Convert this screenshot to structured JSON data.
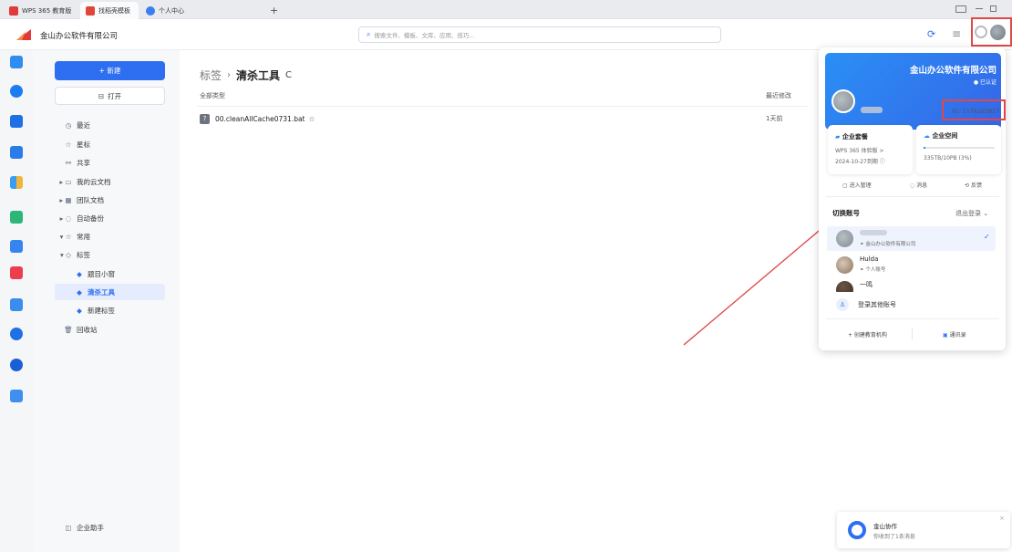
{
  "tabs": [
    {
      "label": "WPS 365 教育版"
    },
    {
      "label": "找稻壳模板"
    },
    {
      "label": "个人中心"
    }
  ],
  "tab_new": "+",
  "header": {
    "company": "金山办公软件有限公司",
    "search_placeholder": "搜索文件、模板、文库、应用、技巧..."
  },
  "nav": {
    "new_label": "+ 新建",
    "open_label": "打开",
    "items": [
      {
        "icon": "◷",
        "label": "最近"
      },
      {
        "icon": "☆",
        "label": "星标"
      },
      {
        "icon": "⚯",
        "label": "共享"
      },
      {
        "icon": "▸ ▭",
        "label": "我的云文档"
      },
      {
        "icon": "▸ ▦",
        "label": "团队文档"
      },
      {
        "icon": "▸ ◌",
        "label": "自动备份"
      },
      {
        "icon": "▾ ☆",
        "label": "常用"
      },
      {
        "icon": "▾ ◇",
        "label": "标签"
      },
      {
        "icon": "◆",
        "label": "题目小窗"
      },
      {
        "icon": "◆",
        "label": "清杀工具"
      },
      {
        "icon": "◆",
        "label": "新建标签"
      },
      {
        "icon": "🗑",
        "label": "回收站"
      }
    ],
    "assistant": "企业助手"
  },
  "main": {
    "crumb_root": "标签",
    "crumb_sep": "›",
    "crumb_current": "清杀工具",
    "refresh": "C",
    "col_type": "全部类型",
    "col_modified": "最近修改",
    "files": [
      {
        "name": "00.cleanAllCache0731.bat",
        "star": "☆",
        "modified": "1天前"
      }
    ]
  },
  "popup": {
    "company": "金山办公软件有限公司",
    "verified": "已认证",
    "id": "ID: 1578263827",
    "plan_title": "企业套餐",
    "plan_name": "WPS 365 体验版 >",
    "plan_expire": "2024-10-27到期 ⓘ",
    "space_title": "企业空间",
    "space_usage": "335TB/10PB (3%)",
    "space_fraction": 0.03,
    "actions": [
      "进入管理",
      "消息",
      "反馈"
    ],
    "switch_title": "切换账号",
    "logout": "退出登录 ⌄",
    "accounts": [
      {
        "name": "",
        "sub": "金山办公软件有限公司",
        "selected": true
      },
      {
        "name": "Hulda",
        "sub": "个人账号",
        "selected": false
      },
      {
        "name": "一鸣",
        "sub": "",
        "selected": false
      }
    ],
    "login_other": "登录其他账号",
    "create_org": "+ 创建教育机构",
    "contacts": "通讯录"
  },
  "toast": {
    "title": "金山协作",
    "body": "你收到了1条消息"
  },
  "colors": {
    "accent": "#2e6ff2",
    "highlight": "#e04848"
  }
}
